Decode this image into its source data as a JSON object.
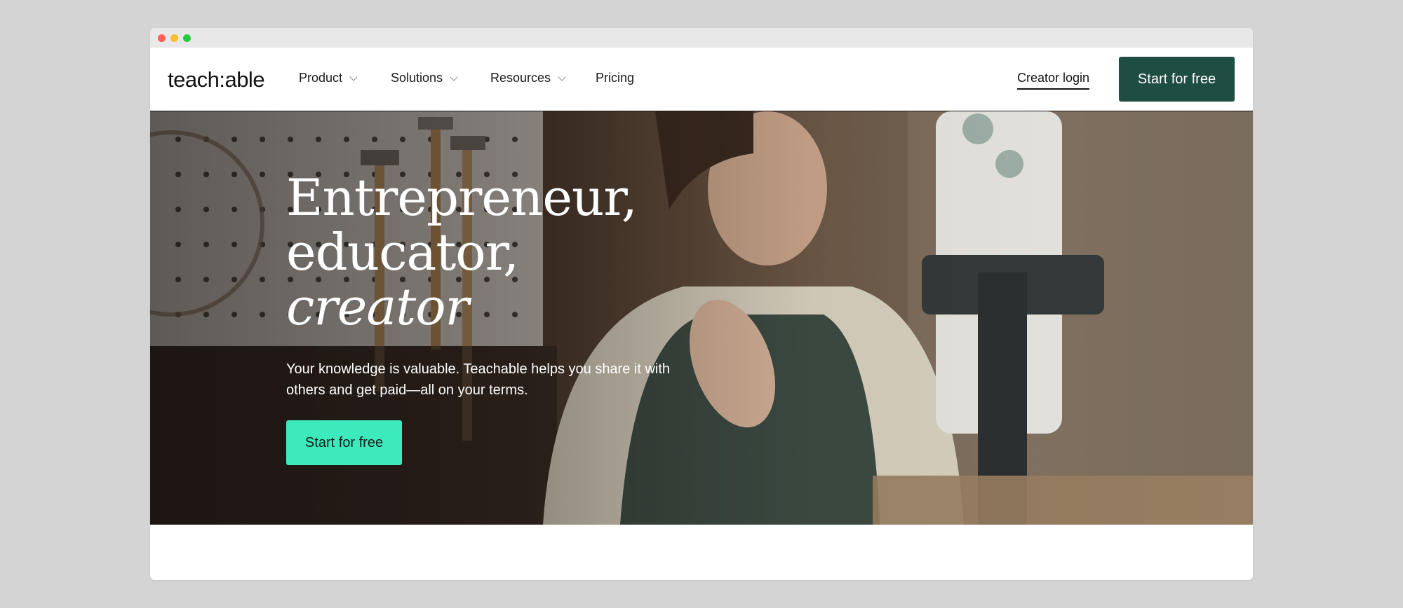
{
  "brand": {
    "logo_text": "teach:able"
  },
  "nav": {
    "items": [
      {
        "label": "Product",
        "has_dropdown": true
      },
      {
        "label": "Solutions",
        "has_dropdown": true
      },
      {
        "label": "Resources",
        "has_dropdown": true
      },
      {
        "label": "Pricing",
        "has_dropdown": false
      }
    ],
    "login_label": "Creator login",
    "cta_label": "Start for free"
  },
  "hero": {
    "headline_line1": "Entrepreneur,",
    "headline_line2": "educator,",
    "headline_line3": "creator",
    "subtext": "Your knowledge is valuable. Teachable helps you share it with others and get paid—all on your terms.",
    "cta_label": "Start for free"
  },
  "colors": {
    "nav_cta_bg": "#1e4d42",
    "hero_cta_bg": "#3deabc",
    "page_bg": "#d4d4d4"
  }
}
